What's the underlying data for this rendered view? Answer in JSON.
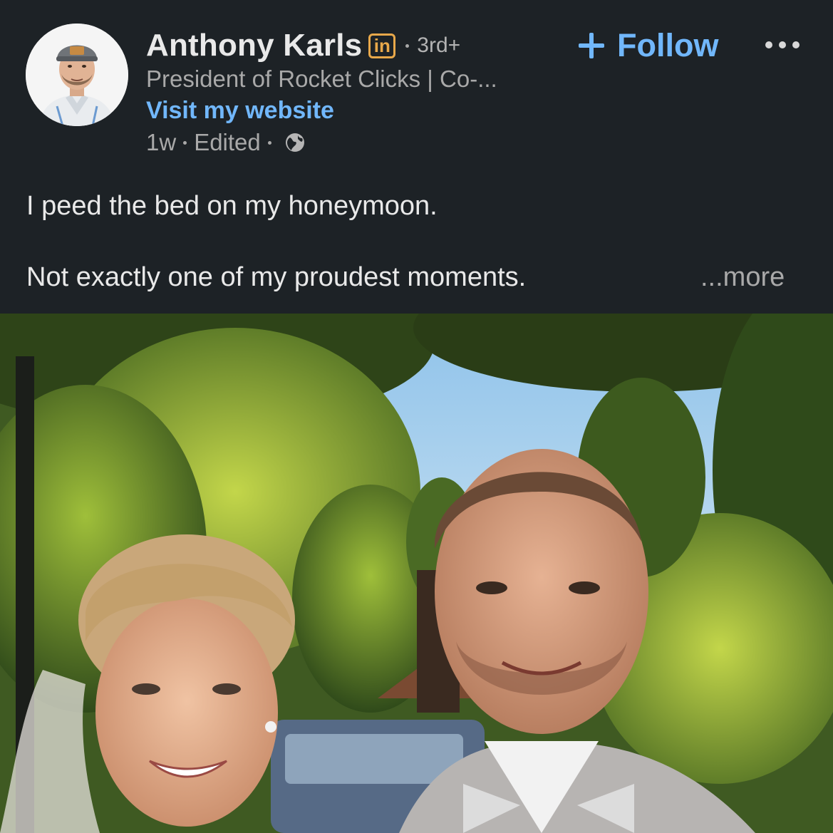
{
  "post": {
    "author": {
      "name": "Anthony Karls",
      "badge": "in",
      "connection_degree": "3rd+",
      "headline": "President of Rocket Clicks | Co-...",
      "website_link": "Visit my website",
      "avatar_icon": "profile-photo"
    },
    "meta": {
      "age": "1w",
      "edited": "Edited",
      "visibility_icon": "globe-icon"
    },
    "actions": {
      "follow_label": "Follow",
      "follow_icon": "plus-icon",
      "overflow_icon": "more-dots-icon"
    },
    "text": {
      "line1": "I peed the bed on my honeymoon.",
      "line2": "Not exactly one of my proudest moments.",
      "see_more": "...more"
    },
    "image": {
      "subject": "wedding-photo"
    }
  },
  "colors": {
    "background": "#1d2226",
    "link": "#71b7fb",
    "badge": "#e8a84a",
    "secondary_text": "#a9a9a9"
  }
}
